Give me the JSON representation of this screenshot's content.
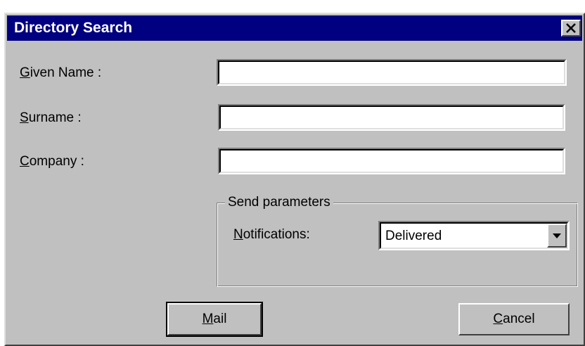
{
  "window": {
    "title": "Directory Search"
  },
  "fields": {
    "given_name": {
      "accel": "G",
      "rest": "iven Name :",
      "value": ""
    },
    "surname": {
      "accel": "S",
      "rest": "urname :",
      "value": ""
    },
    "company": {
      "accel": "C",
      "rest": "ompany :",
      "value": ""
    }
  },
  "send_parameters": {
    "legend": "Send parameters",
    "notifications": {
      "accel": "N",
      "rest": "otifications:",
      "selected": "Delivered"
    }
  },
  "buttons": {
    "mail": {
      "accel": "M",
      "rest": "ail"
    },
    "cancel": {
      "accel": "C",
      "rest": "ancel"
    }
  },
  "icons": {
    "close": "close-icon",
    "dropdown": "chevron-down-icon"
  },
  "colors": {
    "titlebar": "#000080",
    "dialog_bg": "#c0c0c0"
  }
}
